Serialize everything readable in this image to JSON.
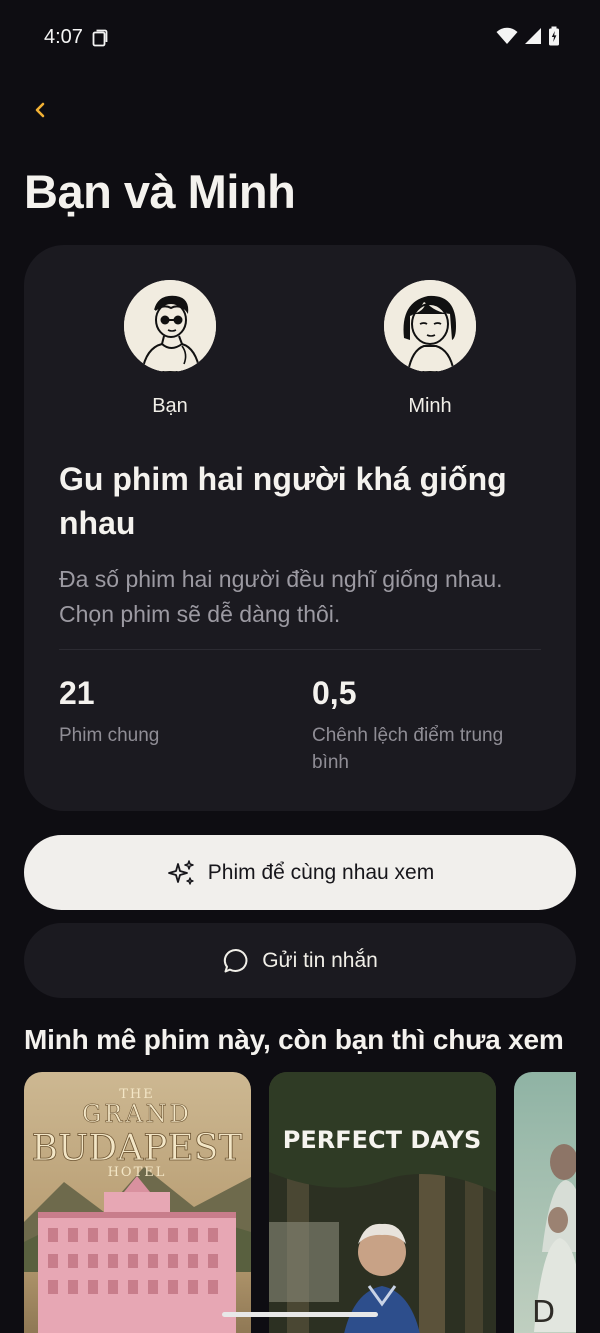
{
  "status_bar": {
    "time": "4:07",
    "icons": [
      "note-icon",
      "wifi-icon",
      "signal-icon",
      "battery-icon"
    ]
  },
  "nav": {
    "back_icon": "chevron-left-icon"
  },
  "page": {
    "title": "Bạn và Minh"
  },
  "compare": {
    "you": {
      "name": "Bạn"
    },
    "friend": {
      "name": "Minh"
    },
    "headline": "Gu phim hai người khá giống nhau",
    "description": "Đa số phim hai người đều nghĩ giống nhau. Chọn phim sẽ dễ dàng thôi.",
    "stats": [
      {
        "value": "21",
        "label": "Phim chung"
      },
      {
        "value": "0,5",
        "label": "Chênh lệch điểm trung bình"
      }
    ]
  },
  "actions": {
    "watch_together": "Phim để cùng nhau xem",
    "send_message": "Gửi tin nhắn"
  },
  "section": {
    "title": "Minh mê phim này, còn bạn thì chưa xem",
    "posters": [
      {
        "line1": "THE",
        "line2": "GRAND",
        "line3": "BUDAPEST",
        "line4": "HOTEL"
      },
      {
        "title": "PERFECT DAYS"
      },
      {
        "mark": "D"
      }
    ]
  },
  "colors": {
    "background": "#0e0d12",
    "card": "#1b1a20",
    "accent": "#f2b134",
    "primary_button": "#f1efec"
  }
}
